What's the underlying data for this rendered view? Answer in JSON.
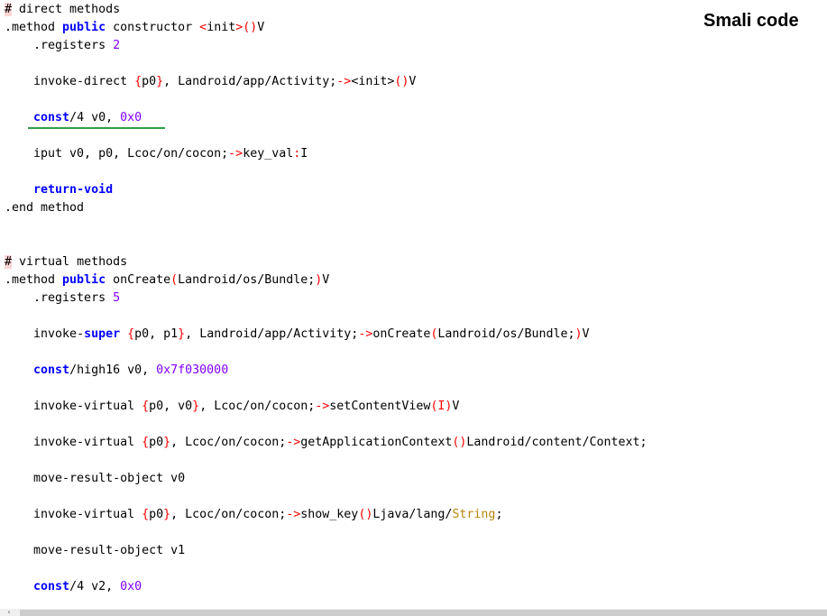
{
  "title_label": "Smali code",
  "scroll_left_glyph": "‹",
  "colors": {
    "keyword": "#0000ff",
    "register_braces": "#ff0000",
    "literal": "#8000ff",
    "string_type": "#b8860b",
    "underline": "#2e9e44"
  },
  "lines": {
    "l01": {
      "hash": "#",
      "rest": " direct methods"
    },
    "l02": {
      "a": ".method ",
      "kw": "public",
      "b": " constructor ",
      "lt": "<",
      "c": "init",
      "gt": ">",
      "paren": "()",
      "d": "V"
    },
    "l03": {
      "a": "    .registers ",
      "num": "2"
    },
    "l05": {
      "a": "    invoke-direct ",
      "ob": "{",
      "c": "p0",
      "cb": "}",
      "d": ", Landroid/app/Activity;",
      "arrow": "->",
      "lt": "<",
      "e": "init",
      "gt": ">",
      "paren": "()",
      "f": "V"
    },
    "l07": {
      "indent": "    ",
      "kw": "const",
      "a": "/4 v0, ",
      "num": "0x0"
    },
    "l09": {
      "a": "    iput v0, p0, Lcoc/on/cocon;",
      "arrow": "->",
      "b": "key_val",
      "colon": ":",
      "c": "I"
    },
    "l11": {
      "indent": "    ",
      "kw": "return-void"
    },
    "l12": {
      "a": ".end method"
    },
    "l15": {
      "hash": "#",
      "rest": " virtual methods"
    },
    "l16": {
      "a": ".method ",
      "kw": "public",
      "b": " onCreate",
      "op": "(",
      "c": "Landroid/os/Bundle;",
      "cp": ")",
      "d": "V"
    },
    "l17": {
      "a": "    .registers ",
      "num": "5"
    },
    "l19": {
      "a": "    invoke-",
      "kw": "super",
      "b": " ",
      "ob": "{",
      "c": "p0, p1",
      "cb": "}",
      "d": ", Landroid/app/Activity;",
      "arrow": "->",
      "e": "onCreate",
      "op": "(",
      "f": "Landroid/os/Bundle;",
      "cp": ")",
      "g": "V"
    },
    "l21": {
      "indent": "    ",
      "kw": "const",
      "a": "/high16 v0, ",
      "num": "0x7f030000"
    },
    "l23": {
      "a": "    invoke-virtual ",
      "ob": "{",
      "c": "p0, v0",
      "cb": "}",
      "d": ", Lcoc/on/cocon;",
      "arrow": "->",
      "e": "setContentView",
      "op": "(",
      "f": "I",
      "cp": ")",
      "g": "V"
    },
    "l25": {
      "a": "    invoke-virtual ",
      "ob": "{",
      "c": "p0",
      "cb": "}",
      "d": ", Lcoc/on/cocon;",
      "arrow": "->",
      "e": "getApplicationContext",
      "paren": "()",
      "f": "Landroid/content/Context;"
    },
    "l27": {
      "a": "    move-result-object v0"
    },
    "l29": {
      "a": "    invoke-virtual ",
      "ob": "{",
      "c": "p0",
      "cb": "}",
      "d": ", Lcoc/on/cocon;",
      "arrow": "->",
      "e": "show_key",
      "paren": "()",
      "f": "Ljava/lang/",
      "str": "String",
      "g": ";"
    },
    "l31": {
      "a": "    move-result-object v1"
    },
    "l33": {
      "indent": "    ",
      "kw": "const",
      "a": "/4 v2, ",
      "num": "0x0"
    }
  }
}
